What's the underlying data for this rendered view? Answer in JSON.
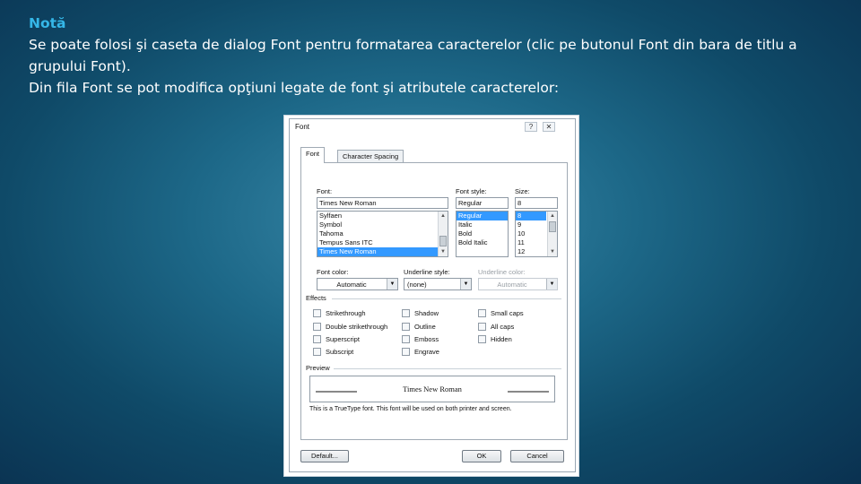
{
  "slide": {
    "heading": "Notă",
    "line1": "Se poate folosi şi caseta de dialog Font pentru formatarea caracterelor (clic pe butonul Font din bara de titlu a grupului Font).",
    "line2": "Din fila Font se pot modifica opţiuni legate de font şi atributele caracterelor:"
  },
  "dialog": {
    "title": "Font",
    "help_glyph": "?",
    "close_glyph": "✕",
    "tabs": [
      "Font",
      "Character Spacing"
    ],
    "font": {
      "label": "Font:",
      "value": "Times New Roman",
      "items": [
        "Sylfaen",
        "Symbol",
        "Tahoma",
        "Tempus Sans ITC",
        "Times New Roman"
      ],
      "selected_index": 4
    },
    "style": {
      "label": "Font style:",
      "value": "Regular",
      "items": [
        "Regular",
        "Italic",
        "Bold",
        "Bold Italic"
      ],
      "selected_index": 0
    },
    "size": {
      "label": "Size:",
      "value": "8",
      "items": [
        "8",
        "9",
        "10",
        "11",
        "12"
      ],
      "selected_index": 0
    },
    "font_color": {
      "label": "Font color:",
      "value": "Automatic"
    },
    "underline_style": {
      "label": "Underline style:",
      "value": "(none)"
    },
    "underline_color": {
      "label": "Underline color:",
      "value": "Automatic"
    },
    "effects": {
      "label": "Effects",
      "col1": [
        "Strikethrough",
        "Double strikethrough",
        "Superscript",
        "Subscript"
      ],
      "col2": [
        "Shadow",
        "Outline",
        "Emboss",
        "Engrave"
      ],
      "col3": [
        "Small caps",
        "All caps",
        "Hidden"
      ]
    },
    "preview": {
      "label": "Preview",
      "sample": "Times New Roman",
      "note": "This is a TrueType font. This font will be used on both printer and screen."
    },
    "buttons": {
      "default": "Default...",
      "ok": "OK",
      "cancel": "Cancel"
    }
  }
}
